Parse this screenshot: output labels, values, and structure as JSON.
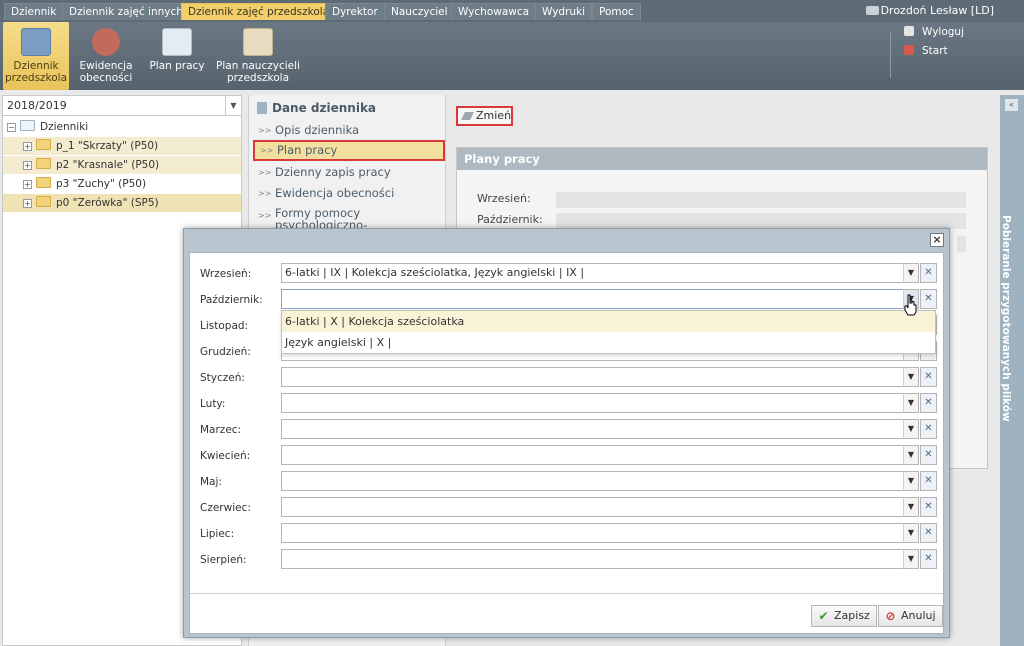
{
  "top_menu": {
    "tabs": [
      "Dziennik",
      "Dziennik zajęć innych",
      "Dziennik zajęć przedszkola",
      "Dyrektor",
      "Nauczyciel",
      "Wychowawca",
      "Wydruki",
      "Pomoc"
    ],
    "active_tab": "Dziennik zajęć przedszkola",
    "user": "Drozdoń Lesław [LD]"
  },
  "ribbon": {
    "buttons": [
      {
        "label": "Dziennik\nprzedszkola",
        "icon": "preschool-journal-icon"
      },
      {
        "label": "Ewidencja\nobecności",
        "icon": "attendance-icon"
      },
      {
        "label": "Plan pracy",
        "icon": "work-plan-icon"
      },
      {
        "label": "Plan nauczycieli\nprzedszkola",
        "icon": "teachers-plan-icon"
      }
    ],
    "logout": "Wyloguj",
    "start": "Start"
  },
  "tree": {
    "year": "2018/2019",
    "root": "Dzienniki",
    "items": [
      "p_1 \"Skrzaty\" (P50)",
      "p2 \"Krasnale\" (P50)",
      "p3 \"Zuchy\" (P50)",
      "p0 \"Zerówka\" (SP5)"
    ]
  },
  "nav": {
    "title": "Dane dziennika",
    "items": [
      "Opis dziennika",
      "Plan pracy",
      "Dzienny zapis pracy",
      "Ewidencja obecności",
      "Formy pomocy psychologiczno-pedagogicznej"
    ],
    "selected": "Plan pracy"
  },
  "content": {
    "change_button": "Zmień",
    "panel_title": "Plany pracy",
    "rows": [
      "Wrzesień:",
      "Październik:"
    ]
  },
  "right_sidebar": {
    "label": "Pobieranie przygotowanych plików"
  },
  "modal": {
    "months": [
      {
        "label": "Wrzesień:",
        "value": "6-latki | IX | Kolekcja sześciolatka, Język angielski | IX |"
      },
      {
        "label": "Październik:",
        "value": ""
      },
      {
        "label": "Listopad:",
        "value": ""
      },
      {
        "label": "Grudzień:",
        "value": ""
      },
      {
        "label": "Styczeń:",
        "value": ""
      },
      {
        "label": "Luty:",
        "value": ""
      },
      {
        "label": "Marzec:",
        "value": ""
      },
      {
        "label": "Kwiecień:",
        "value": ""
      },
      {
        "label": "Maj:",
        "value": ""
      },
      {
        "label": "Czerwiec:",
        "value": ""
      },
      {
        "label": "Lipiec:",
        "value": ""
      },
      {
        "label": "Sierpień:",
        "value": ""
      }
    ],
    "dropdown_options": [
      "6-latki | X | Kolekcja sześciolatka",
      "Język angielski | X |"
    ],
    "save": "Zapisz",
    "cancel": "Anuluj"
  }
}
